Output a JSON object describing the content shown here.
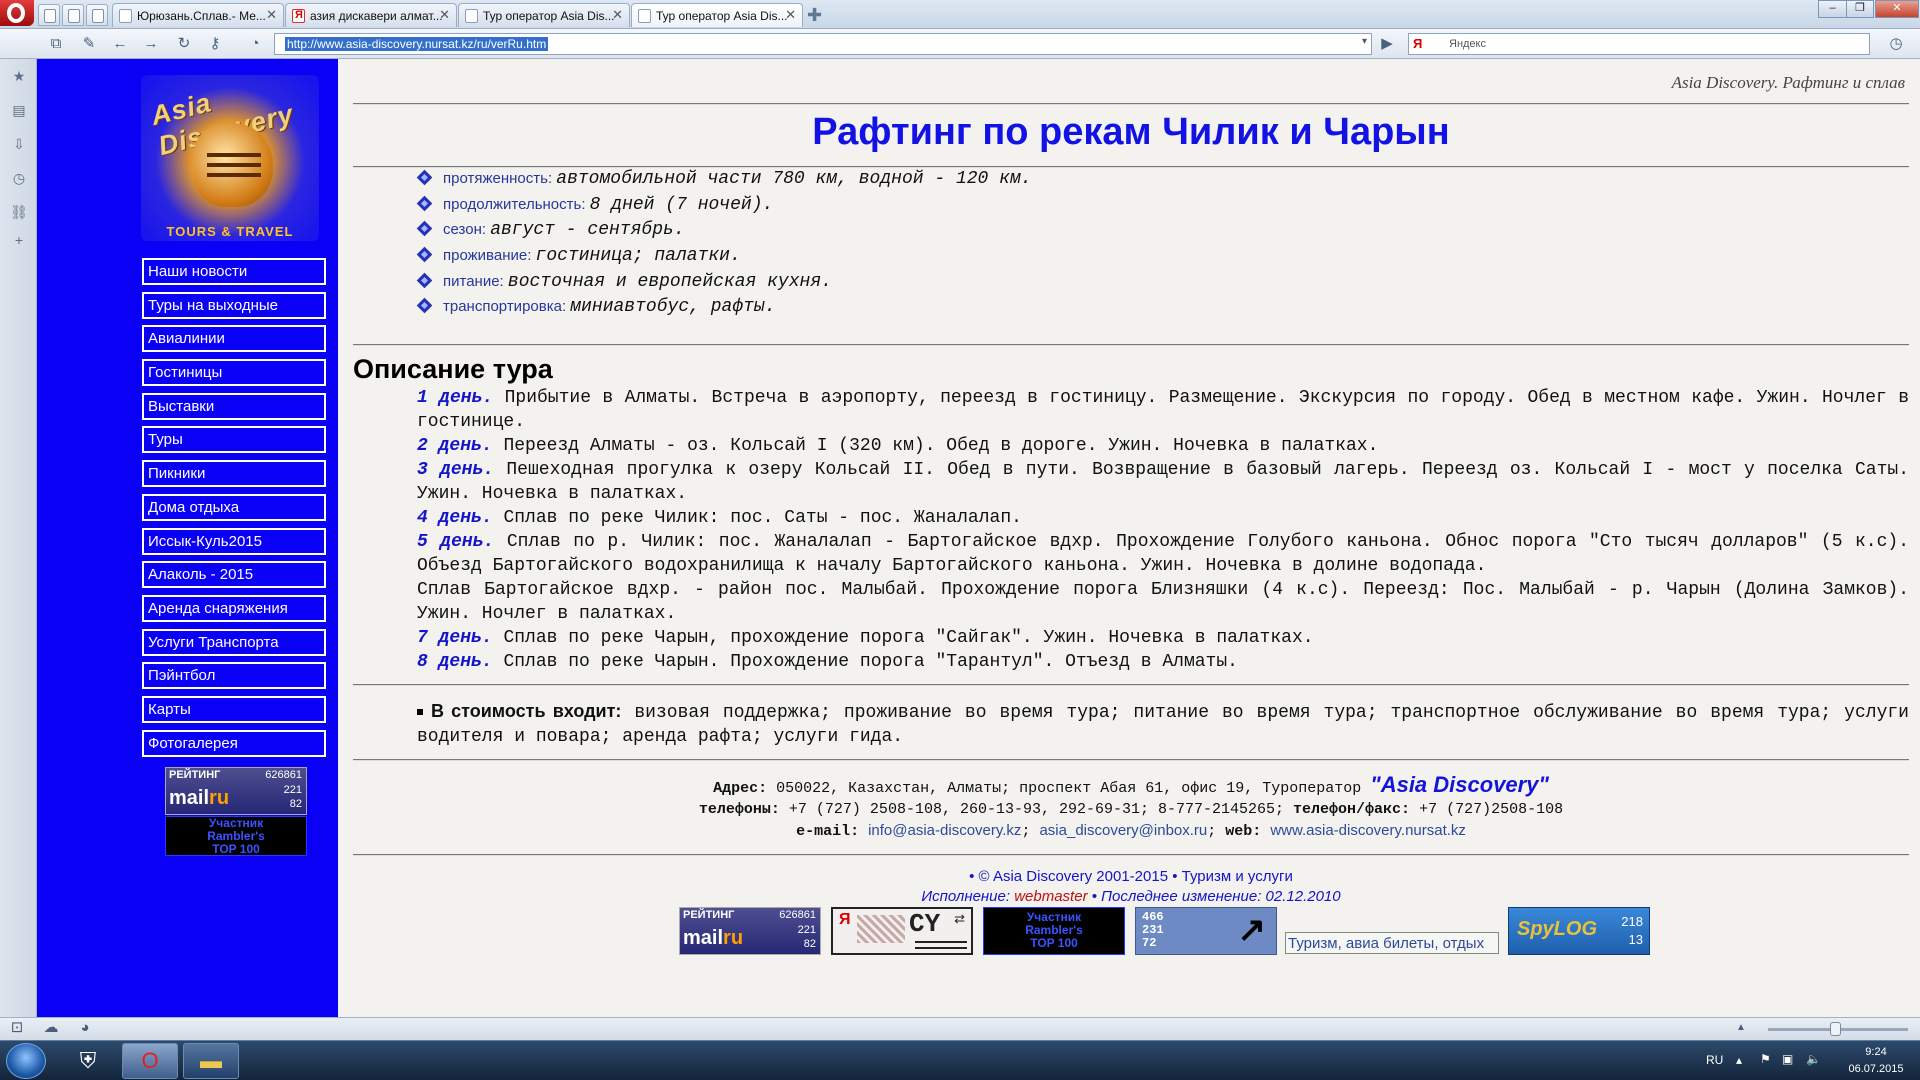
{
  "browser": {
    "tabs": [
      {
        "title": "Юрюзань.Сплав.- Ме..."
      },
      {
        "title": "азия дискавери алмат..."
      },
      {
        "title": "Тур оператор Asia Dis..."
      },
      {
        "title": "Тур оператор Asia Dis..."
      }
    ],
    "address": "http://www.asia-discovery.nursat.kz/ru/verRu.htm",
    "search_placeholder": "Яндекс",
    "search_engine_label": "Я"
  },
  "page": {
    "crumb": "Asia Discovery. Рафтинг и сплав",
    "title": "Рафтинг по рекам Чилик и Чарын",
    "logo": {
      "brand": "Asia Discovery",
      "tagline": "TOURS & TRAVEL"
    },
    "menu": [
      "Наши новости",
      "Туры на выходные",
      "Авиалинии",
      "Гостиницы",
      "Выставки",
      "Туры",
      "Пикники",
      "Дома отдыха",
      "Иссык-Куль2015",
      "Алаколь - 2015",
      "Аренда снаряжения",
      "Услуги Транспорта",
      "Пэйнтбол",
      "Карты",
      "Фотогалерея"
    ],
    "facts": [
      {
        "key": "протяженность:",
        "value": "автомобильной части 780 км, водной - 120 км."
      },
      {
        "key": "продолжительность:",
        "value": "8 дней (7 ночей)."
      },
      {
        "key": "сезон:",
        "value": "август - сентябрь."
      },
      {
        "key": "проживание:",
        "value": "гостиница; палатки."
      },
      {
        "key": "питание:",
        "value": "восточная и европейская кухня."
      },
      {
        "key": "транспортировка:",
        "value": "миниавтобус, рафты."
      }
    ],
    "description_heading": "Описание тура",
    "days": [
      {
        "label": "1 день.",
        "text": "Прибытие в Алматы. Встреча в аэропорту, переезд в гостиницу. Размещение. Экскурсия по городу. Обед в местном кафе. Ужин. Ночлег в гостинице."
      },
      {
        "label": "2 день.",
        "text": "Переезд Алматы - оз. Кольсай I (320 км). Обед в дороге. Ужин. Ночевка в палатках."
      },
      {
        "label": "3 день.",
        "text": "Пешеходная прогулка к озеру Кольсай II. Обед в пути. Возвращение в базовый лагерь. Переезд оз. Кольсай I - мост у поселка Саты. Ужин. Ночевка в палатках."
      },
      {
        "label": "4 день.",
        "text": "Сплав по реке Чилик: пос. Саты - пос. Жаналалап."
      },
      {
        "label": "5 день.",
        "text": "Сплав по р. Чилик: пос. Жаналалап - Бартогайское вдхр. Прохождение Голубого каньона. Обнос порога \"Сто тысяч долларов\" (5 к.с). Объезд Бартогайского водохранилища к началу Бартогайского каньона. Ужин. Ночевка в долине водопада."
      },
      {
        "label": "",
        "text": "Сплав Бартогайское вдхр. - район пос. Малыбай. Прохождение порога Близняшки (4 к.с). Переезд: Пос. Малыбай - р. Чарын (Долина Замков). Ужин. Ночлег в палатках."
      },
      {
        "label": "7 день.",
        "text": "Сплав по реке Чарын, прохождение порога \"Сайгак\". Ужин. Ночевка в палатках."
      },
      {
        "label": "8 день.",
        "text": "Сплав по реке Чарын. Прохождение порога \"Тарантул\". Отъезд в Алматы."
      }
    ],
    "included_label": "В стоимость входит:",
    "included_text": "визовая поддержка; проживание во время тура; питание во время тура; транспортное обслуживание во время тура; услуги водителя и повара; аренда рафта; услуги гида.",
    "contacts": {
      "address_label": "Адрес:",
      "address": "050022, Казахстан, Алматы; проспект Абая 61, офис 19, Туроператор",
      "company": "\"Asia Discovery\"",
      "phones_label": "телефоны:",
      "phones": "+7 (727) 2508-108,   260-13-93,   292-69-31; 8-777-2145265;",
      "fax_label": "телефон/факс:",
      "fax": "+7 (727)2508-108",
      "email_label": "e-mail:",
      "email1": "info@asia-discovery.kz",
      "email2": "asia_discovery@inbox.ru",
      "web_label": "web:",
      "web": "www.asia-discovery.nursat.kz"
    },
    "copyright": "• © Asia Discovery 2001-2015 • Туризм и услуги",
    "execution_label": "Исполнение:",
    "webmaster": "webmaster",
    "last_change": "• Последнее изменение: 02.12.2010",
    "tourism_link": "Туризм, авиа билеты, отдых"
  },
  "badges": {
    "mail_title": "РЕЙТИНГ",
    "mail_total": "626861",
    "mail_a": "221",
    "mail_b": "82",
    "mail_logo": "mail",
    "mail_logo_suffix": "ru",
    "rambler_lines": [
      "Участник",
      "Rambler's",
      "TOP 100"
    ],
    "counter_lines": [
      "466",
      "231",
      "72"
    ],
    "cy_text": "CY",
    "spylog_text": "SpyLOG",
    "spylog_a": "218",
    "spylog_b": "13"
  },
  "statusbar": {},
  "taskbar": {
    "lang": "RU",
    "time": "9:24",
    "date": "06.07.2015"
  }
}
